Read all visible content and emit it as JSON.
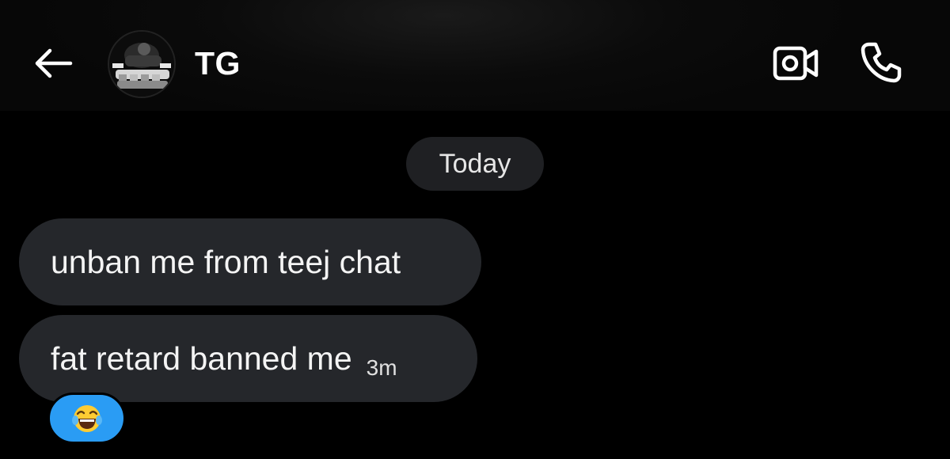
{
  "header": {
    "contact_name": "TG",
    "back_icon": "arrow-left-icon",
    "video_icon": "video-call-icon",
    "phone_icon": "phone-call-icon"
  },
  "conversation": {
    "date_separator": "Today",
    "messages": [
      {
        "text": "unban me from teej chat",
        "time": ""
      },
      {
        "text": "fat retard banned me",
        "time": "3m"
      }
    ],
    "reaction": {
      "emoji": "face-with-tears-of-joy-icon",
      "color": "#2a9cf4"
    }
  },
  "colors": {
    "background": "#000000",
    "bubble": "#25272b",
    "accent": "#2a9cf4"
  }
}
